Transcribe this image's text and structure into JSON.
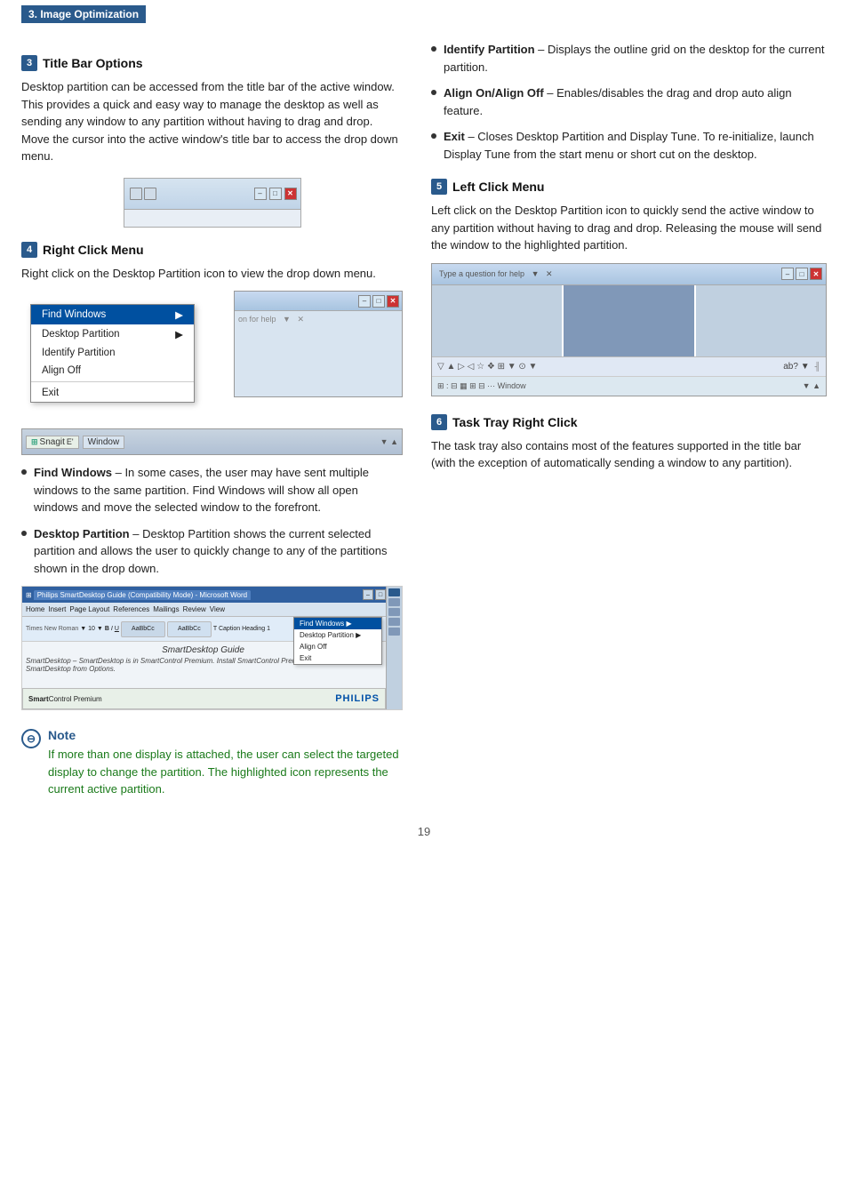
{
  "header": {
    "label": "3. Image Optimization"
  },
  "section3": {
    "num": "3",
    "title": "Title Bar Options",
    "body": "Desktop partition can be accessed from the title bar of the active window. This provides a quick and easy way to manage the desktop as well as sending any window to any partition without having to drag and drop. Move the cursor into the active window's title bar to access the drop down menu."
  },
  "section4": {
    "num": "4",
    "title": "Right Click Menu",
    "body": "Right click on the Desktop Partition icon to view the drop down menu.",
    "menu_items": [
      {
        "label": "Find Windows",
        "has_arrow": true
      },
      {
        "label": "Desktop Partition",
        "has_arrow": true
      },
      {
        "label": "Identify Partition",
        "has_arrow": false
      },
      {
        "label": "Align Off",
        "has_arrow": false
      },
      {
        "label": "Exit",
        "has_arrow": false
      }
    ],
    "bullets": [
      {
        "term": "Find Windows",
        "text": " – In some cases, the user may have sent multiple windows to the same partition.  Find Windows will show all open windows and move the selected window to the forefront."
      },
      {
        "term": "Desktop Partition",
        "text": " – Desktop Partition shows the current selected partition and allows the user to quickly change to any of the partitions shown in the drop down."
      }
    ]
  },
  "section5": {
    "num": "5",
    "title": "Left Click Menu",
    "body": "Left click on the Desktop Partition icon to quickly send the active window to any partition without having to drag and drop. Releasing the mouse will send the window to the highlighted partition."
  },
  "section6": {
    "num": "6",
    "title": "Task Tray Right Click",
    "body": "The task tray also contains most of the features supported in the title bar (with the exception of automatically sending a window to any partition)."
  },
  "right_click_menu": {
    "find_windows": "Find Windows",
    "desktop_partition": "Desktop Partition",
    "identify_partition": "Identify Partition",
    "align_off": "Align Off",
    "exit": "Exit"
  },
  "taskbar": {
    "snagit": "Snagit",
    "window": "Window"
  },
  "bullet_items": {
    "identify_partition": {
      "term": "Identify Partition",
      "text": " – Displays the outline grid on the desktop for the current partition."
    },
    "align_on_off": {
      "term": "Align On/Align Off",
      "text": " – Enables/disables the drag and drop auto align feature."
    },
    "exit": {
      "term": "Exit",
      "text": " – Closes Desktop Partition and Display Tune.  To re-initialize, launch Display Tune from the start menu or short cut on the desktop."
    }
  },
  "note": {
    "title": "Note",
    "text": "If more than one display is attached, the user can select the targeted display to change the partition. The highlighted icon represents the current active partition."
  },
  "footer": {
    "page_num": "19"
  },
  "window_controls": {
    "minimize": "–",
    "restore": "□",
    "close": "✕"
  },
  "smartdesktop": {
    "title": "SmartDesktop Guide",
    "text": "SmartDesktop – SmartDesktop is in SmartControl Premium. Install SmartControl Premium and select SmartDesktop from Options.",
    "sc_label": "SmartControl Premium",
    "philips": "PHILIPS"
  }
}
